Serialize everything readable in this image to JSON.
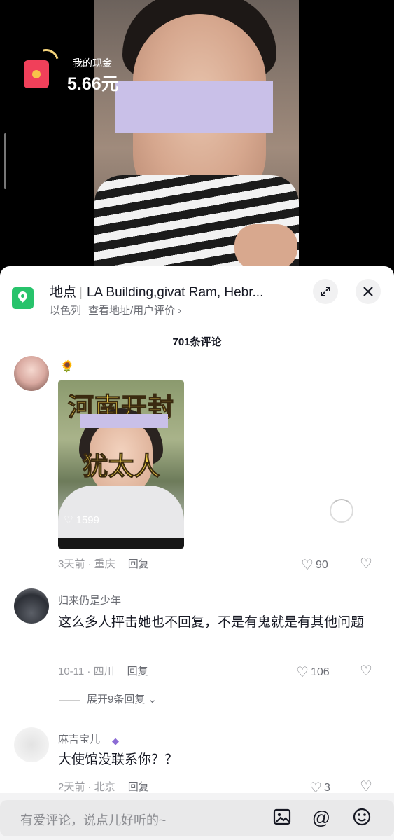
{
  "overlay": {
    "cash_label": "我的现金",
    "cash_value": "5.66元"
  },
  "location": {
    "title_prefix": "地点",
    "title_name": "LA Building,givat Ram, Hebr...",
    "country": "以色列",
    "sub_link": "查看地址/用户评价 ›"
  },
  "comments_header": "701条评论",
  "comments": [
    {
      "author": "",
      "badge": "🌻",
      "thumbnail": {
        "line1": "河南开封",
        "line2": "犹太人",
        "likes": "♡ 1599"
      },
      "time_place": "3天前 · 重庆",
      "reply_label": "回复",
      "likes": "90"
    },
    {
      "author": "归来仍是少年",
      "text": "这么多人抨击她也不回复，不是有鬼就是有其他问题",
      "time_place": "10-11 · 四川",
      "reply_label": "回复",
      "likes": "106",
      "expand_label": "展开9条回复"
    },
    {
      "author": "麻吉宝儿",
      "text": "大使馆没联系你？？",
      "time_place": "2天前 · 北京",
      "reply_label": "回复",
      "likes": "3"
    }
  ],
  "input": {
    "placeholder": "有爱评论，说点儿好听的~"
  },
  "icons": {
    "expand": "expand-icon",
    "close": "close-icon",
    "image": "image-icon",
    "mention": "at-icon",
    "emoji": "emoji-icon"
  }
}
